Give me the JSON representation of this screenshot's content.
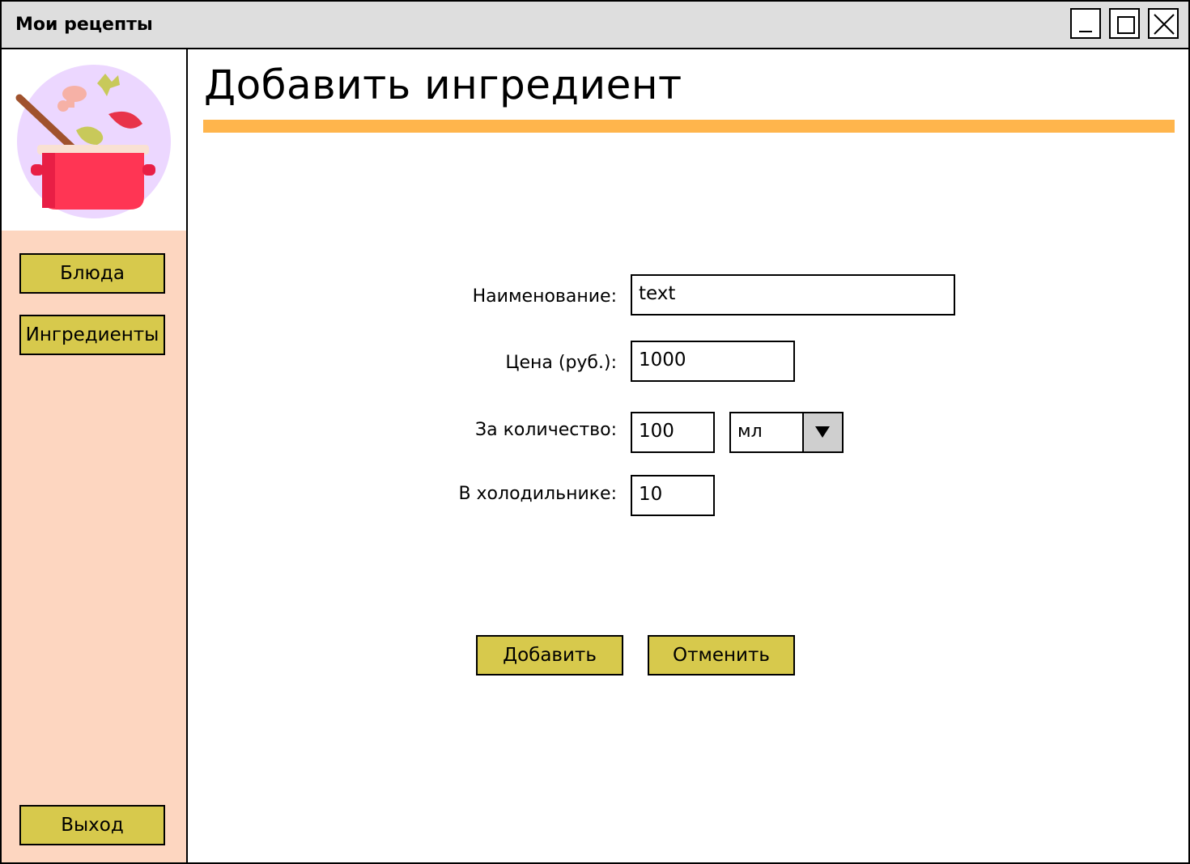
{
  "window": {
    "title": "Мои рецепты"
  },
  "sidebar": {
    "items": [
      {
        "label": "Блюда"
      },
      {
        "label": "Ингредиенты"
      }
    ],
    "exit_label": "Выход"
  },
  "page": {
    "title": "Добавить ингредиент"
  },
  "form": {
    "name_label": "Наименование:",
    "name_value": "text",
    "price_label": "Цена (руб.):",
    "price_value": "1000",
    "quantity_label": "За количество:",
    "quantity_value": "100",
    "unit_value": "мл",
    "fridge_label": "В холодильнике:",
    "fridge_value": "10"
  },
  "actions": {
    "add_label": "Добавить",
    "cancel_label": "Отменить"
  },
  "colors": {
    "titlebar": "#dedede",
    "sidebar": "#fdd6c0",
    "button": "#d7c94c",
    "accent": "#ffb54c"
  }
}
